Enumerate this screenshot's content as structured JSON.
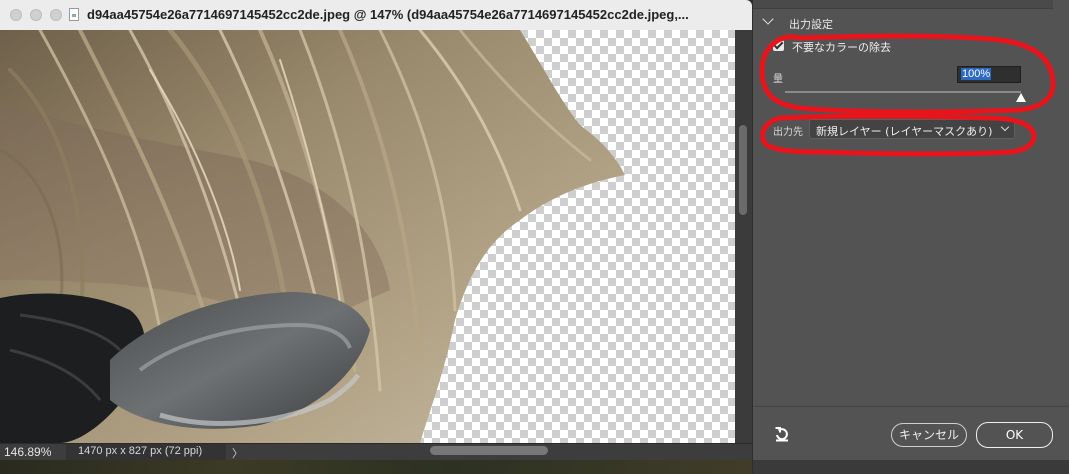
{
  "document": {
    "title": "d94aa45754e26a7714697145452cc2de.jpeg @ 147% (d94aa45754e26a7714697145452cc2de.jpeg,...",
    "zoom": "146.89%",
    "size_info": "1470 px x 827 px (72 ppi)",
    "status_chevron": "〉"
  },
  "dialog": {
    "section_title": "出力設定",
    "checkbox_label": "不要なカラーの除去",
    "checkbox_checked": true,
    "amount_label": "量",
    "amount_value": "100%",
    "output_label": "出力先",
    "output_value": "新規レイヤー (レイヤーマスクあり)",
    "cancel_label": "キャンセル",
    "ok_label": "OK"
  },
  "colors": {
    "annotation": "#e8141c",
    "dialog_bg": "#535353",
    "selection": "#2b6bc4"
  }
}
